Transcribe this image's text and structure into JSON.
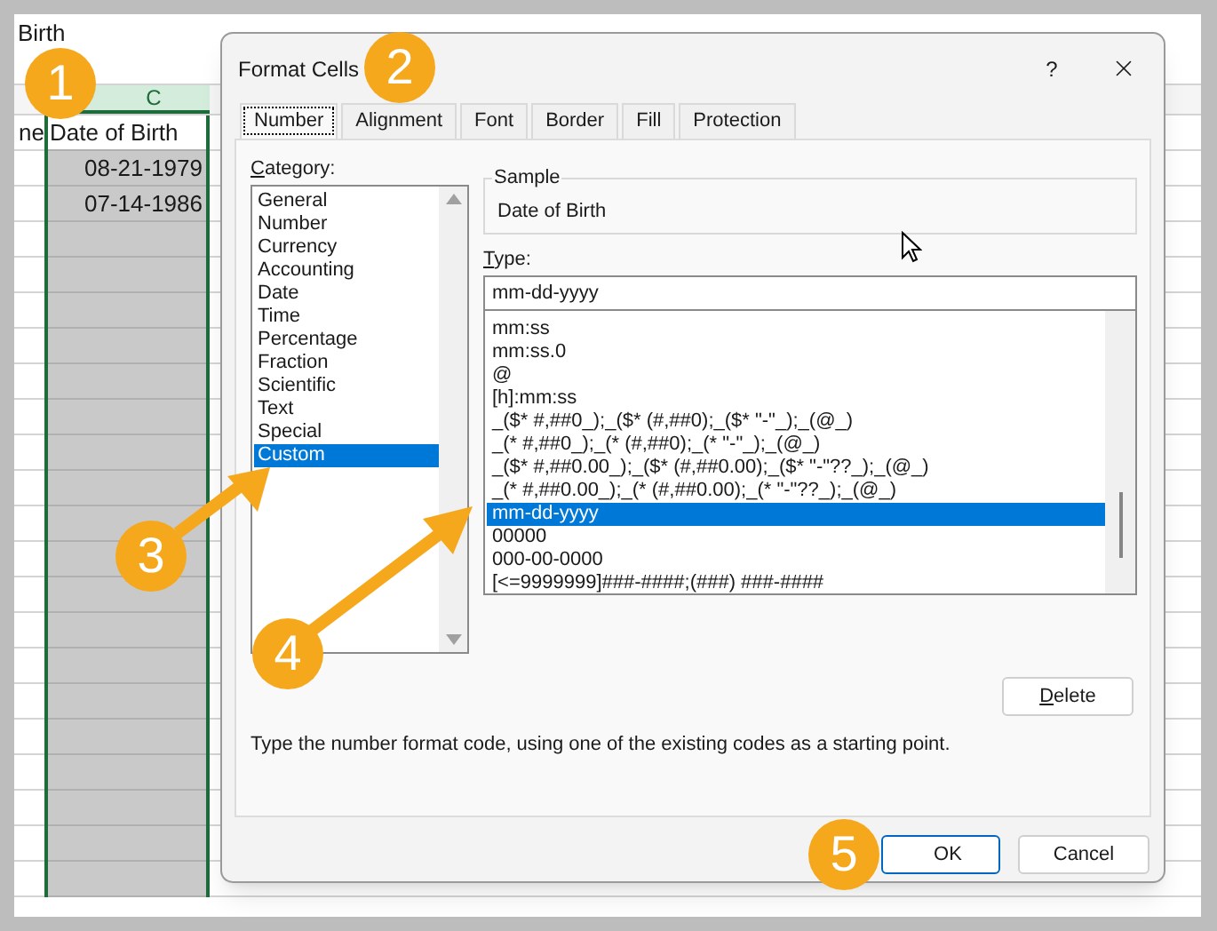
{
  "spreadsheet": {
    "formula_text": "Birth",
    "column_header": "C",
    "header_cells": [
      "ne",
      "Date of Birth"
    ],
    "date_cells": [
      "08-21-1979",
      "07-14-1986"
    ]
  },
  "dialog": {
    "title": "Format Cells",
    "help": "?",
    "tabs": [
      {
        "label": "Number",
        "selected": true
      },
      {
        "label": "Alignment",
        "selected": false
      },
      {
        "label": "Font",
        "selected": false
      },
      {
        "label": "Border",
        "selected": false
      },
      {
        "label": "Fill",
        "selected": false
      },
      {
        "label": "Protection",
        "selected": false
      }
    ],
    "category_label": "Category:",
    "categories": [
      {
        "label": "General",
        "selected": false
      },
      {
        "label": "Number",
        "selected": false
      },
      {
        "label": "Currency",
        "selected": false
      },
      {
        "label": "Accounting",
        "selected": false
      },
      {
        "label": "Date",
        "selected": false
      },
      {
        "label": "Time",
        "selected": false
      },
      {
        "label": "Percentage",
        "selected": false
      },
      {
        "label": "Fraction",
        "selected": false
      },
      {
        "label": "Scientific",
        "selected": false
      },
      {
        "label": "Text",
        "selected": false
      },
      {
        "label": "Special",
        "selected": false
      },
      {
        "label": "Custom",
        "selected": true
      }
    ],
    "sample_label": "Sample",
    "sample_value": "Date of Birth",
    "type_label": "Type:",
    "type_value": "mm-dd-yyyy",
    "type_options": [
      {
        "label": "mm:ss",
        "selected": false
      },
      {
        "label": "mm:ss.0",
        "selected": false
      },
      {
        "label": "@",
        "selected": false
      },
      {
        "label": "[h]:mm:ss",
        "selected": false
      },
      {
        "label": "_($* #,##0_);_($* (#,##0);_($* \"-\"_);_(@_)",
        "selected": false
      },
      {
        "label": "_(* #,##0_);_(* (#,##0);_(* \"-\"_);_(@_)",
        "selected": false
      },
      {
        "label": "_($* #,##0.00_);_($* (#,##0.00);_($* \"-\"??_);_(@_)",
        "selected": false
      },
      {
        "label": "_(* #,##0.00_);_(* (#,##0.00);_(* \"-\"??_);_(@_)",
        "selected": false
      },
      {
        "label": "mm-dd-yyyy",
        "selected": true
      },
      {
        "label": "00000",
        "selected": false
      },
      {
        "label": "000-00-0000",
        "selected": false
      },
      {
        "label": "[<=9999999]###-####;(###) ###-####",
        "selected": false
      }
    ],
    "delete_button": "Delete",
    "hint": "Type the number format code, using one of the existing codes as a starting point.",
    "ok_button": "OK",
    "cancel_button": "Cancel"
  },
  "callouts": [
    "1",
    "2",
    "3",
    "4",
    "5"
  ]
}
